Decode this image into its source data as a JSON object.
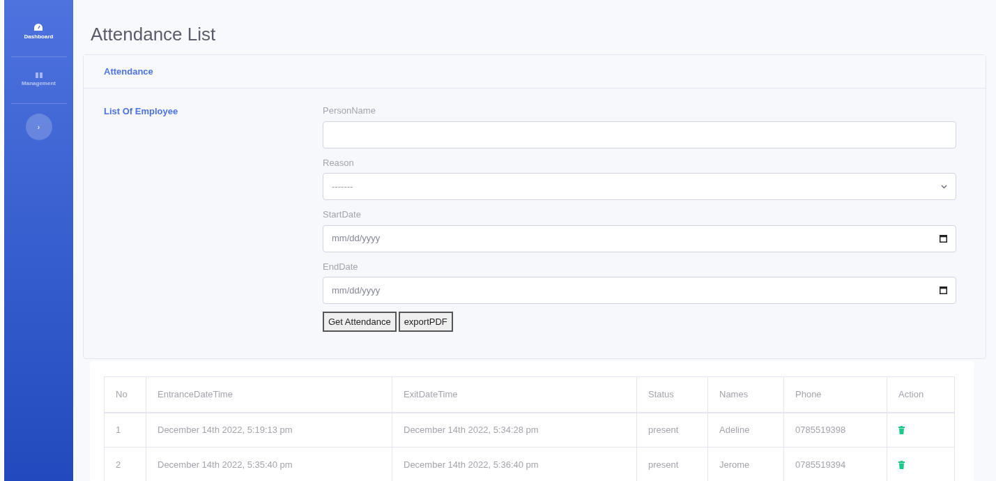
{
  "sidebar": {
    "items": [
      {
        "label": "Dashboard",
        "selected": true
      },
      {
        "label": "Management",
        "selected": false
      }
    ],
    "toggle": "›"
  },
  "page_title": "Attendance List",
  "card": {
    "header": "Attendance",
    "left_label": "List Of Employee",
    "fields": [
      {
        "kind": "text",
        "label": "PersonName"
      },
      {
        "kind": "select",
        "label": "Reason",
        "value": "-------"
      },
      {
        "kind": "date",
        "label": "StartDate",
        "placeholder": "mm/dd/yyyy"
      },
      {
        "kind": "date",
        "label": "EndDate",
        "placeholder": "mm/dd/yyyy"
      }
    ],
    "buttons": [
      "Get Attendance",
      "exportPDF"
    ]
  },
  "table": {
    "columns": [
      "No",
      "EntranceDateTime",
      "ExitDateTime",
      "Status",
      "Names",
      "Phone",
      "Action"
    ],
    "rows": [
      {
        "no": "1",
        "entrance": "December 14th 2022, 5:19:13 pm",
        "exit": "December 14th 2022, 5:34:28 pm",
        "status": "present",
        "name": "Adeline",
        "phone": "0785519398"
      },
      {
        "no": "2",
        "entrance": "December 14th 2022, 5:35:40 pm",
        "exit": "December 14th 2022, 5:36:40 pm",
        "status": "present",
        "name": "Jerome",
        "phone": "0785519394"
      }
    ]
  }
}
